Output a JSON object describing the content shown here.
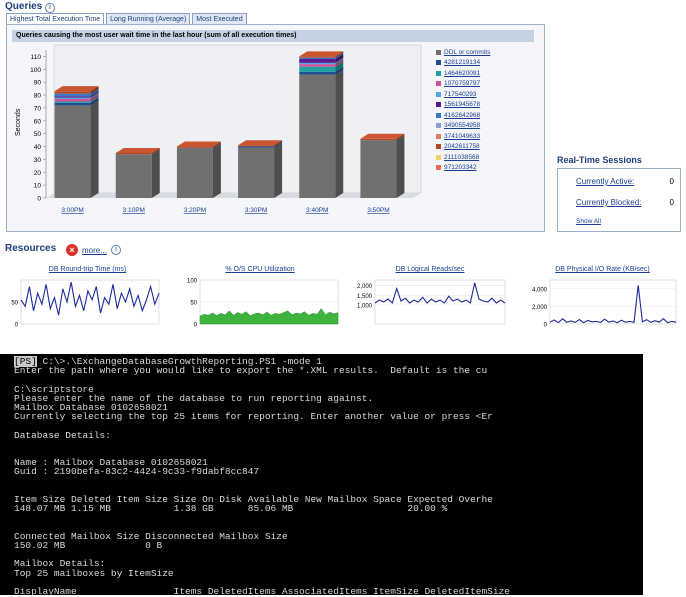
{
  "queries": {
    "title": "Queries",
    "tabs": [
      "Highest Total Execution Time",
      "Long Running (Average)",
      "Most Executed"
    ],
    "chart_header": "Queries causing the most user wait time in the last hour (sum of all execution times)"
  },
  "chart_data": [
    {
      "type": "bar",
      "title": "Queries causing the most user wait time in the last hour (sum of all execution times)",
      "ylabel": "Seconds",
      "ylim": [
        0,
        115
      ],
      "yticks": [
        0,
        10,
        20,
        30,
        40,
        50,
        60,
        70,
        80,
        90,
        100,
        110
      ],
      "categories": [
        "3:00PM",
        "3:10PM",
        "3:20PM",
        "3:30PM",
        "3:40PM",
        "3:50PM"
      ],
      "series": [
        {
          "name": "DDL or commits",
          "color": "#707070",
          "values": [
            72,
            34,
            39,
            39,
            96,
            45
          ]
        },
        {
          "name": "4281219134",
          "color": "#1e4e96",
          "values": [
            2,
            0,
            0,
            1,
            2,
            0
          ]
        },
        {
          "name": "1464620091",
          "color": "#20a0a0",
          "values": [
            1,
            0,
            0,
            0,
            4,
            0
          ]
        },
        {
          "name": "1070759797",
          "color": "#d0509a",
          "values": [
            2,
            0,
            0,
            0,
            2,
            0
          ]
        },
        {
          "name": "717540293",
          "color": "#50a8e0",
          "values": [
            1,
            0,
            0,
            0,
            1,
            0
          ]
        },
        {
          "name": "1561945678",
          "color": "#5a1a90",
          "values": [
            1,
            0,
            0,
            0,
            3,
            0
          ]
        },
        {
          "name": "4162642968",
          "color": "#3a78c8",
          "values": [
            2,
            0,
            0,
            0,
            1,
            0
          ]
        },
        {
          "name": "3490554958",
          "color": "#8a9ed0",
          "values": [
            0,
            0,
            0,
            0,
            0,
            0
          ]
        },
        {
          "name": "3741049633",
          "color": "#e08060",
          "values": [
            0,
            0,
            0,
            0,
            0,
            0
          ]
        },
        {
          "name": "2042611758",
          "color": "#b04a2a",
          "values": [
            2,
            1,
            1,
            1,
            1,
            1
          ]
        },
        {
          "name": "2111038568",
          "color": "#f0d060",
          "values": [
            0,
            0,
            0,
            0,
            0,
            0
          ]
        },
        {
          "name": "971203342",
          "color": "#e87050",
          "values": [
            0,
            0,
            0,
            0,
            0,
            0
          ]
        }
      ]
    },
    {
      "type": "line",
      "title": "DB Round-trip Time (ms)",
      "ylim": [
        0,
        100
      ],
      "yticks": [
        0,
        50
      ],
      "color": "#1c2a9c",
      "values": [
        55,
        40,
        85,
        30,
        70,
        45,
        90,
        35,
        60,
        20,
        80,
        50,
        95,
        40,
        65,
        30,
        75,
        55,
        85,
        25,
        60,
        45,
        90,
        35,
        70,
        50,
        80,
        40,
        65,
        30,
        55,
        85,
        45,
        70
      ]
    },
    {
      "type": "area",
      "title": "% O/S CPU Utilization",
      "ylim": [
        0,
        100
      ],
      "yticks": [
        0,
        50,
        100
      ],
      "color": "#3db33d",
      "values": [
        18,
        22,
        20,
        25,
        19,
        24,
        21,
        30,
        20,
        26,
        22,
        28,
        19,
        23,
        25,
        21,
        27,
        20,
        24,
        22,
        26,
        30,
        21,
        25,
        23,
        28,
        20,
        24,
        22,
        35,
        21,
        27,
        23,
        26
      ]
    },
    {
      "type": "line",
      "title": "DB Logical Reads/sec",
      "ylim": [
        0,
        2300
      ],
      "yticks": [
        1000,
        1500,
        2000
      ],
      "color": "#1c2a9c",
      "values": [
        1100,
        1250,
        1150,
        1300,
        1100,
        1850,
        1200,
        1350,
        1100,
        1250,
        1150,
        1400,
        1100,
        1300,
        1150,
        1250,
        1100,
        1450,
        1200,
        1300,
        1150,
        1250,
        1100,
        2150,
        1300,
        1200,
        1150,
        1350,
        1100,
        1250,
        1100
      ]
    },
    {
      "type": "line",
      "title": "DB Physical I/O Rate (KB/sec)",
      "ylim": [
        0,
        5000
      ],
      "yticks": [
        0,
        2000,
        4000
      ],
      "color": "#1c2a9c",
      "values": [
        200,
        450,
        150,
        600,
        200,
        350,
        180,
        500,
        150,
        400,
        250,
        300,
        180,
        550,
        200,
        350,
        150,
        420,
        200,
        300,
        180,
        4400,
        250,
        500,
        180,
        380,
        200,
        600,
        150,
        300,
        200
      ]
    }
  ],
  "realtime": {
    "title": "Real-Time Sessions",
    "active_label": "Currently Active:",
    "active_value": "0",
    "blocked_label": "Currently Blocked:",
    "blocked_value": "0",
    "show_all": "Show All"
  },
  "resources": {
    "title": "Resources",
    "more": "more..."
  },
  "terminal": {
    "lines": [
      "C:\\>.\\ExchangeDatabaseGrowthReporting.PS1 -mode 1",
      "Enter the path where you would like to export the *.XML results.  Default is the cu",
      "",
      "C:\\scriptstore",
      "Please enter the name of the database to run reporting against.",
      "Mailbox Database 0102658021",
      "Currently selecting the top 25 items for reporting. Enter another value or press <Er",
      "",
      "Database Details:",
      "",
      "",
      "Name : Mailbox Database 0102658021",
      "Guid : 2190befa-83c2-4424-9c33-f9dabf8cc847",
      "",
      "",
      "Item Size Deleted Item Size Size On Disk Available New Mailbox Space Expected Overhe",
      "148.07 MB 1.15 MB           1.38 GB      85.06 MB                    20.00 %",
      "",
      "",
      "Connected Mailbox Size Disconnected Mailbox Size",
      "150.02 MB              0 B",
      "",
      "Mailbox Details:",
      "Top 25 mailboxes by ItemSize",
      "",
      "DisplayName                 Items DeletedItems AssociatedItems ItemSize DeletedItemSize"
    ],
    "prompt_prefix": "[PS]"
  }
}
